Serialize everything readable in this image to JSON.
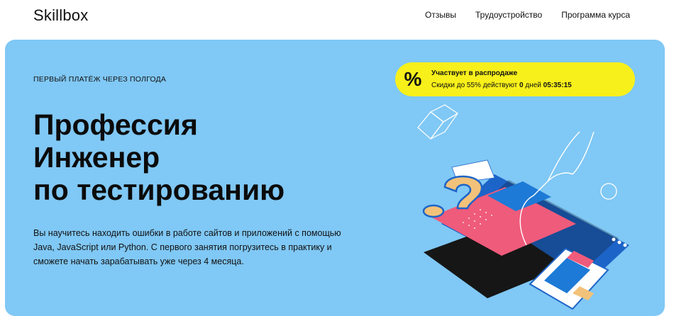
{
  "header": {
    "logo": "Skillbox",
    "nav": [
      "Отзывы",
      "Трудоустройство",
      "Программа курса"
    ]
  },
  "hero": {
    "kicker": "Первый платёж через полгода",
    "title_lines": [
      "Профессия",
      "Инженер",
      "по тестированию"
    ],
    "description": "Вы научитесь находить ошибки в работе сайтов и приложений с помощью Java, JavaScript или Python. С первого занятия погрузитесь в практику и сможете начать зарабатывать уже через 4 месяца."
  },
  "promo": {
    "icon": "percent-icon",
    "icon_glyph": "%",
    "title": "Участвует в распродаже",
    "sub_prefix": "Скидки до 55% действуют",
    "days": "0",
    "days_label": "дней",
    "timer": "05:35:15"
  },
  "colors": {
    "hero_bg": "#80c8f5",
    "promo_bg": "#f8f01b",
    "accent_pink": "#ef5b7b",
    "accent_blue": "#1d64c8"
  }
}
